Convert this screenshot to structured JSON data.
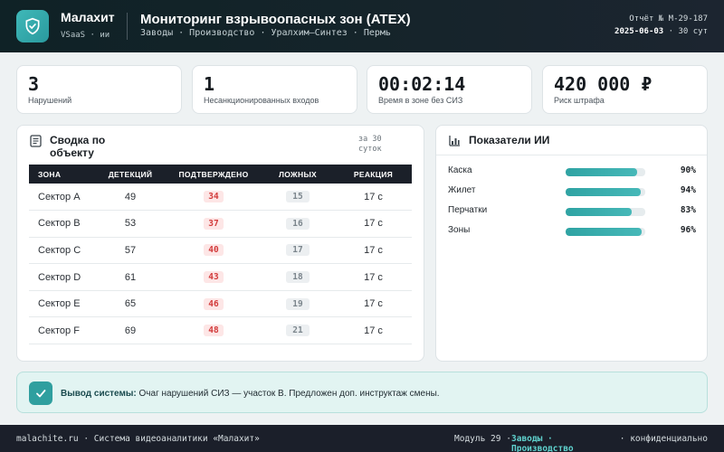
{
  "header": {
    "brand": "Малахит",
    "brand_sub": "VSaaS · ии",
    "title": "Мониторинг взрывоопасных зон (ATEX)",
    "breadcrumb": "Заводы · Производство · Уралхим—Синтез · Пермь",
    "report": "Отчёт № М-29-187",
    "date": "2025-06-03",
    "period": "· 30 сут"
  },
  "kpis": [
    {
      "value": "3",
      "label": "Нарушений"
    },
    {
      "value": "1",
      "label": "Несанкционированных входов"
    },
    {
      "value": "00:02:14",
      "label": "Время в зоне без СИЗ"
    },
    {
      "value": "420 000 ₽",
      "label": "Риск штрафа"
    }
  ],
  "summary": {
    "title": "Сводка по объекту",
    "period": "за 30 суток",
    "columns": [
      "ЗОНА",
      "ДЕТЕКЦИЙ",
      "ПОДТВЕРЖДЕНО",
      "ЛОЖНЫХ",
      "РЕАКЦИЯ"
    ],
    "rows": [
      {
        "zone": "Сектор A",
        "detections": "49",
        "confirmed": "34",
        "false": "15",
        "reaction": "17 с"
      },
      {
        "zone": "Сектор B",
        "detections": "53",
        "confirmed": "37",
        "false": "16",
        "reaction": "17 с"
      },
      {
        "zone": "Сектор C",
        "detections": "57",
        "confirmed": "40",
        "false": "17",
        "reaction": "17 с"
      },
      {
        "zone": "Сектор D",
        "detections": "61",
        "confirmed": "43",
        "false": "18",
        "reaction": "17 с"
      },
      {
        "zone": "Сектор E",
        "detections": "65",
        "confirmed": "46",
        "false": "19",
        "reaction": "17 с"
      },
      {
        "zone": "Сектор F",
        "detections": "69",
        "confirmed": "48",
        "false": "21",
        "reaction": "17 с"
      }
    ]
  },
  "ai": {
    "title": "Показатели ИИ",
    "items": [
      {
        "name": "Каска",
        "pct": "90%",
        "value": 0.9
      },
      {
        "name": "Жилет",
        "pct": "94%",
        "value": 0.94
      },
      {
        "name": "Перчатки",
        "pct": "83%",
        "value": 0.83
      },
      {
        "name": "Зоны",
        "pct": "96%",
        "value": 0.96
      }
    ]
  },
  "verdict": {
    "label": "Вывод системы:",
    "text": "Очаг нарушений СИЗ — участок B. Предложен доп. инструктаж смены."
  },
  "footer": {
    "left": "malachite.ru · Система видеоаналитики «Малахит»",
    "module": "Модуль 29 ·",
    "nav": "Заводы · Производство",
    "right": "· конфиденциально"
  },
  "colors": {
    "accent": "#2f9f9f",
    "danger": "#d23c3c",
    "header": "#16242b"
  }
}
